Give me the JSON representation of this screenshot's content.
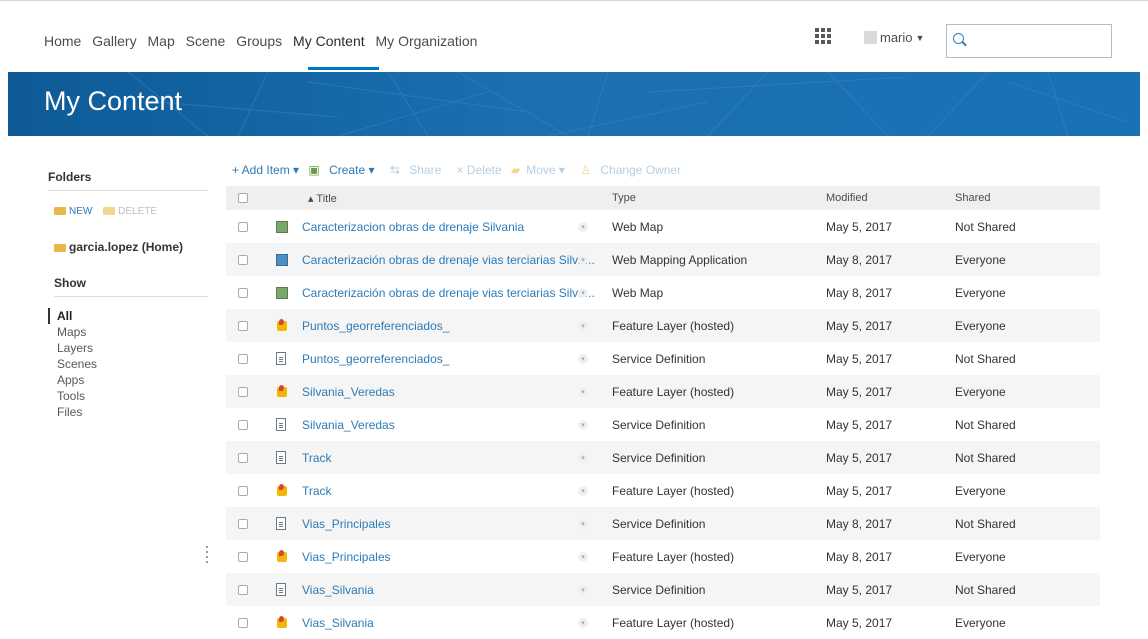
{
  "nav": {
    "links": [
      "Home",
      "Gallery",
      "Map",
      "Scene",
      "Groups",
      "My Content",
      "My Organization"
    ],
    "active": "My Content",
    "user": "mario",
    "search_placeholder": ""
  },
  "page_title": "My Content",
  "sidebar": {
    "folders_heading": "Folders",
    "new_label": "NEW",
    "delete_label": "DELETE",
    "home_folder": "garcia.lopez (Home)",
    "show_heading": "Show",
    "show_items": [
      "All",
      "Maps",
      "Layers",
      "Scenes",
      "Apps",
      "Tools",
      "Files"
    ],
    "active_show": "All"
  },
  "toolbar": {
    "add_item": "+ Add Item ▾",
    "create": "Create ▾",
    "share": "Share",
    "delete": "× Delete",
    "move": "Move ▾",
    "change_owner": "Change Owner"
  },
  "table": {
    "headers": {
      "title": "▴ Title",
      "type": "Type",
      "modified": "Modified",
      "shared": "Shared"
    },
    "rows": [
      {
        "icon": "web-map-icon",
        "title": "Caracterizacion obras de drenaje Silvania",
        "type": "Web Map",
        "modified": "May 5, 2017",
        "shared": "Not Shared"
      },
      {
        "icon": "web-app-icon",
        "title": "Caracterización obras de drenaje vias terciarias Silva...",
        "type": "Web Mapping Application",
        "modified": "May 8, 2017",
        "shared": "Everyone"
      },
      {
        "icon": "web-map-icon",
        "title": "Caracterización obras de drenaje vias terciarias Silva...",
        "type": "Web Map",
        "modified": "May 8, 2017",
        "shared": "Everyone"
      },
      {
        "icon": "feature-layer-icon",
        "title": "Puntos_georreferenciados_",
        "type": "Feature Layer (hosted)",
        "modified": "May 5, 2017",
        "shared": "Everyone"
      },
      {
        "icon": "service-definition-icon",
        "title": "Puntos_georreferenciados_",
        "type": "Service Definition",
        "modified": "May 5, 2017",
        "shared": "Not Shared"
      },
      {
        "icon": "feature-layer-icon",
        "title": "Silvania_Veredas",
        "type": "Feature Layer (hosted)",
        "modified": "May 5, 2017",
        "shared": "Everyone"
      },
      {
        "icon": "service-definition-icon",
        "title": "Silvania_Veredas",
        "type": "Service Definition",
        "modified": "May 5, 2017",
        "shared": "Not Shared"
      },
      {
        "icon": "service-definition-icon",
        "title": "Track",
        "type": "Service Definition",
        "modified": "May 5, 2017",
        "shared": "Not Shared"
      },
      {
        "icon": "feature-layer-icon",
        "title": "Track",
        "type": "Feature Layer (hosted)",
        "modified": "May 5, 2017",
        "shared": "Everyone"
      },
      {
        "icon": "service-definition-icon",
        "title": "Vias_Principales",
        "type": "Service Definition",
        "modified": "May 8, 2017",
        "shared": "Not Shared"
      },
      {
        "icon": "feature-layer-icon",
        "title": "Vias_Principales",
        "type": "Feature Layer (hosted)",
        "modified": "May 8, 2017",
        "shared": "Everyone"
      },
      {
        "icon": "service-definition-icon",
        "title": "Vias_Silvania",
        "type": "Service Definition",
        "modified": "May 5, 2017",
        "shared": "Not Shared"
      },
      {
        "icon": "feature-layer-icon",
        "title": "Vias_Silvania",
        "type": "Feature Layer (hosted)",
        "modified": "May 5, 2017",
        "shared": "Everyone"
      }
    ]
  },
  "colors": {
    "accent": "#0079c1",
    "link": "#2b7bb9",
    "banner": "#1c6fb0"
  }
}
